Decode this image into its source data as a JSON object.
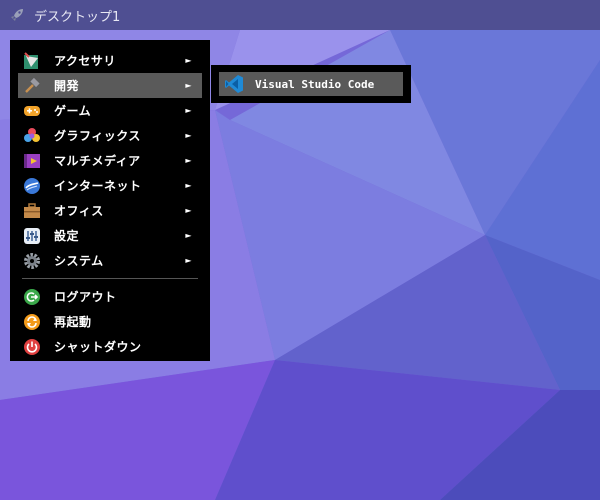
{
  "colors": {
    "panel": "#4f4f92",
    "menu_bg": "#000000",
    "highlight": "#5a5a5a",
    "text": "#ffffff"
  },
  "topbar": {
    "icon": "rocket-icon",
    "title": "デスクトップ1"
  },
  "menu": {
    "arrow": "►",
    "items": [
      {
        "label": "アクセサリ",
        "icon": "accessories-icon",
        "has_submenu": true
      },
      {
        "label": "開発",
        "icon": "development-hammer-icon",
        "has_submenu": true,
        "active": true
      },
      {
        "label": "ゲーム",
        "icon": "gamepad-icon",
        "has_submenu": true
      },
      {
        "label": "グラフィックス",
        "icon": "graphics-icon",
        "has_submenu": true
      },
      {
        "label": "マルチメディア",
        "icon": "multimedia-icon",
        "has_submenu": true
      },
      {
        "label": "インターネット",
        "icon": "internet-globe-icon",
        "has_submenu": true
      },
      {
        "label": "オフィス",
        "icon": "office-briefcase-icon",
        "has_submenu": true
      },
      {
        "label": "設定",
        "icon": "settings-panel-icon",
        "has_submenu": true
      },
      {
        "label": "システム",
        "icon": "system-gear-icon",
        "has_submenu": true
      }
    ],
    "session_items": [
      {
        "label": "ログアウト",
        "icon": "logout-icon"
      },
      {
        "label": "再起動",
        "icon": "restart-icon"
      },
      {
        "label": "シャットダウン",
        "icon": "shutdown-icon"
      }
    ]
  },
  "submenu": {
    "items": [
      {
        "label": "Visual Studio Code",
        "icon": "vscode-icon"
      }
    ]
  }
}
